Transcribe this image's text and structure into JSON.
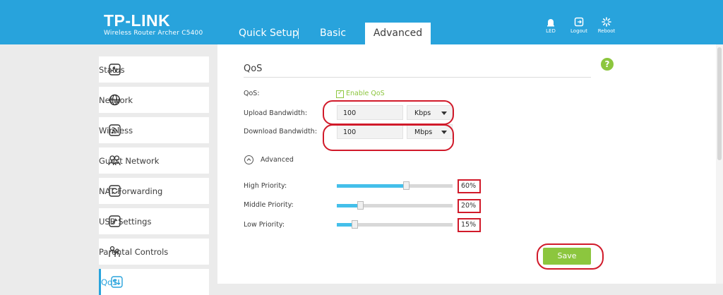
{
  "brand": {
    "logo": "TP-LINK",
    "model": "Wireless Router Archer C5400"
  },
  "nav": {
    "tabs": [
      {
        "label": "Quick Setup"
      },
      {
        "label": "Basic"
      },
      {
        "label": "Advanced"
      }
    ],
    "active": "Advanced"
  },
  "header_icons": [
    {
      "label": "LED",
      "icon": "led-icon"
    },
    {
      "label": "Logout",
      "icon": "logout-icon"
    },
    {
      "label": "Reboot",
      "icon": "reboot-icon"
    }
  ],
  "sidebar": {
    "items": [
      {
        "label": "Status",
        "icon": "status-icon"
      },
      {
        "label": "Network",
        "icon": "globe-icon"
      },
      {
        "label": "Wireless",
        "icon": "wireless-icon"
      },
      {
        "label": "Guest Network",
        "icon": "guest-icon"
      },
      {
        "label": "NAT Forwarding",
        "icon": "nat-icon"
      },
      {
        "label": "USB Settings",
        "icon": "usb-icon"
      },
      {
        "label": "Parental Controls",
        "icon": "parental-icon"
      },
      {
        "label": "QoS",
        "icon": "qos-icon",
        "active": true
      }
    ]
  },
  "main": {
    "title": "QoS",
    "qos_label": "QoS:",
    "enable_label": "Enable QoS",
    "enable_checked": true,
    "upload": {
      "label": "Upload Bandwidth:",
      "value": "100",
      "unit": "Kbps"
    },
    "download": {
      "label": "Download Bandwidth:",
      "value": "100",
      "unit": "Mbps"
    },
    "advanced_label": "Advanced",
    "priorities": [
      {
        "label": "High Priority:",
        "value": 60,
        "display": "60%"
      },
      {
        "label": "Middle Priority:",
        "value": 20,
        "display": "20%"
      },
      {
        "label": "Low Priority:",
        "value": 15,
        "display": "15%"
      }
    ],
    "save_label": "Save"
  },
  "colors": {
    "header_bg": "#28a3dc",
    "accent_green": "#8cc63e",
    "slider_fill": "#44bfea",
    "annotation_red": "#d11a2a"
  }
}
